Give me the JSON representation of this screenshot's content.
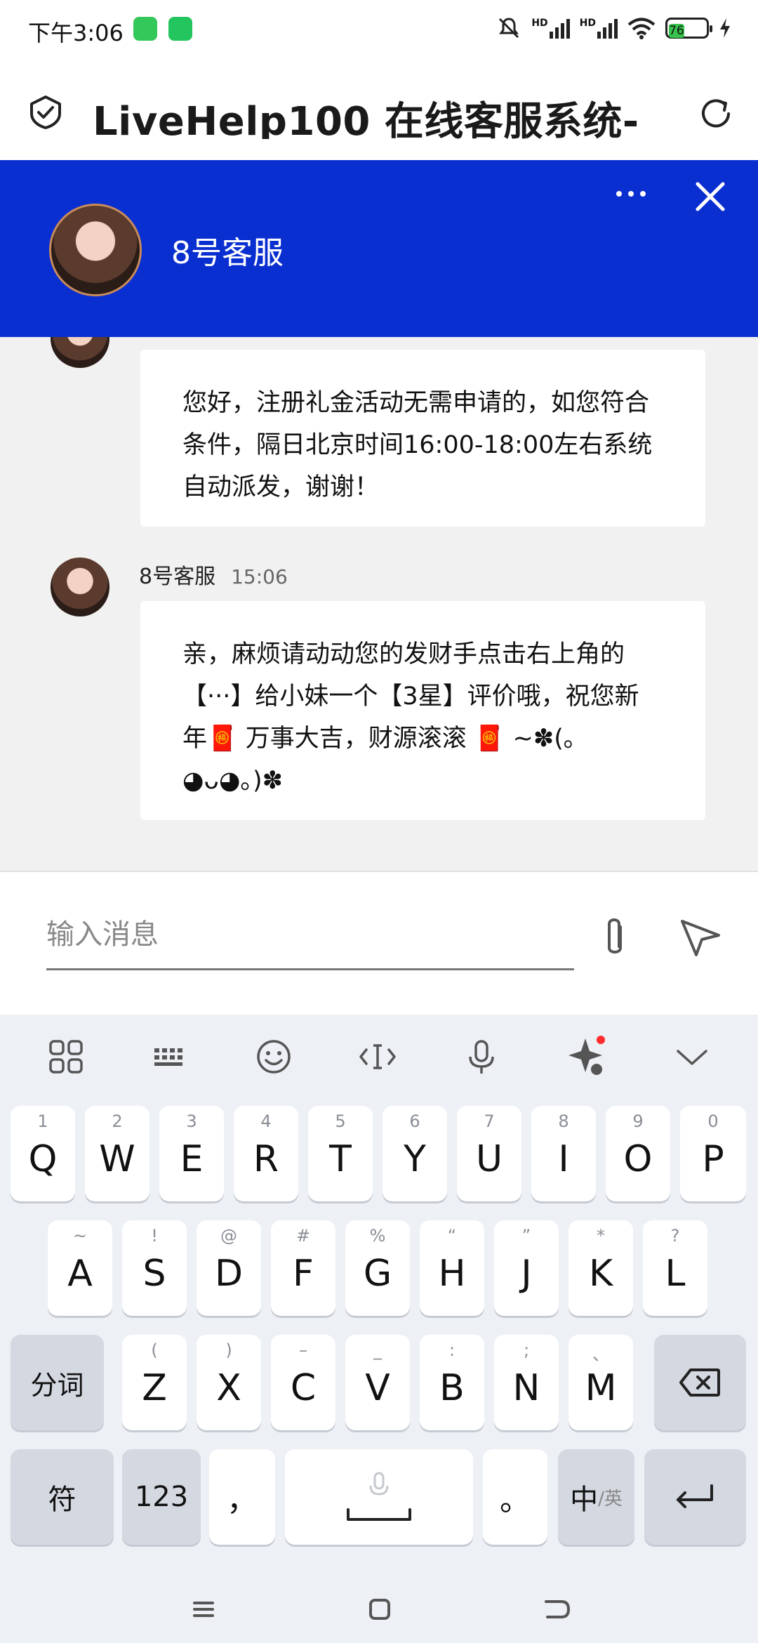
{
  "status_bar": {
    "time": "下午3:06",
    "battery": "76",
    "hd1": "HD",
    "hd2": "HD"
  },
  "browser": {
    "title": "LiveHelp100 在线客服系统-"
  },
  "chat_header": {
    "agent_name": "8号客服"
  },
  "messages": [
    {
      "text": "您好，注册礼金活动无需申请的，如您符合条件，隔日北京时间16:00-18:00左右系统自动派发，谢谢！"
    },
    {
      "sender": "8号客服",
      "time": "15:06",
      "text": "亲，麻烦请动动您的发财手点击右上角的【···】给小妹一个【3星】评价哦，祝您新年🧧 万事大吉，财源滚滚 🧧 ~✽(｡◕ᴗ◕｡)✽"
    }
  ],
  "input": {
    "placeholder": "输入消息"
  },
  "keyboard": {
    "row1": [
      {
        "hint": "1",
        "key": "Q"
      },
      {
        "hint": "2",
        "key": "W"
      },
      {
        "hint": "3",
        "key": "E"
      },
      {
        "hint": "4",
        "key": "R"
      },
      {
        "hint": "5",
        "key": "T"
      },
      {
        "hint": "6",
        "key": "Y"
      },
      {
        "hint": "7",
        "key": "U"
      },
      {
        "hint": "8",
        "key": "I"
      },
      {
        "hint": "9",
        "key": "O"
      },
      {
        "hint": "0",
        "key": "P"
      }
    ],
    "row2": [
      {
        "hint": "~",
        "key": "A"
      },
      {
        "hint": "!",
        "key": "S"
      },
      {
        "hint": "@",
        "key": "D"
      },
      {
        "hint": "#",
        "key": "F"
      },
      {
        "hint": "%",
        "key": "G"
      },
      {
        "hint": "“",
        "key": "H"
      },
      {
        "hint": "”",
        "key": "J"
      },
      {
        "hint": "*",
        "key": "K"
      },
      {
        "hint": "?",
        "key": "L"
      }
    ],
    "row3": [
      {
        "hint": "(",
        "key": "Z"
      },
      {
        "hint": ")",
        "key": "X"
      },
      {
        "hint": "–",
        "key": "C"
      },
      {
        "hint": "_",
        "key": "V"
      },
      {
        "hint": ":",
        "key": "B"
      },
      {
        "hint": ";",
        "key": "N"
      },
      {
        "hint": "、",
        "key": "M"
      }
    ],
    "fenci": "分词",
    "fu": "符",
    "num": "123",
    "comma": "，",
    "period": "。",
    "lang_main": "中",
    "lang_sub": "/英"
  }
}
